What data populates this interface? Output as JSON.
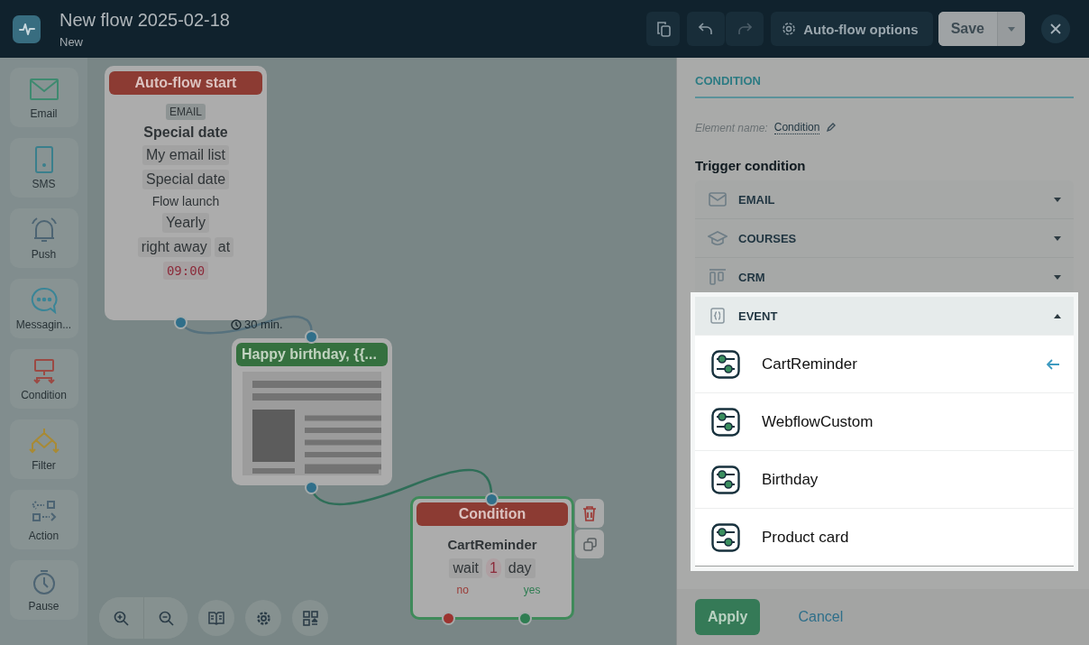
{
  "header": {
    "title": "New flow 2025-02-18",
    "status": "New",
    "options_button": "Auto-flow options",
    "save_button": "Save"
  },
  "palette": [
    {
      "label": "Email",
      "kind": "email"
    },
    {
      "label": "SMS",
      "kind": "sms"
    },
    {
      "label": "Push",
      "kind": "push"
    },
    {
      "label": "Messagin...",
      "kind": "messaging"
    },
    {
      "label": "Condition",
      "kind": "condition"
    },
    {
      "label": "Filter",
      "kind": "filter"
    },
    {
      "label": "Action",
      "kind": "action"
    },
    {
      "label": "Pause",
      "kind": "pause"
    }
  ],
  "canvas": {
    "start_node": {
      "title": "Auto-flow start",
      "lines": [
        {
          "kind": "tag",
          "texts": [
            "EMAIL"
          ]
        },
        {
          "kind": "title",
          "texts": [
            "Special date"
          ]
        },
        {
          "kind": "chip",
          "texts": [
            "My email list"
          ]
        },
        {
          "kind": "chip",
          "texts": [
            "Special date"
          ]
        },
        {
          "kind": "plain",
          "texts": [
            "Flow launch"
          ]
        },
        {
          "kind": "chip",
          "texts": [
            "Yearly"
          ]
        },
        {
          "kind": "chip",
          "texts": [
            "right away",
            "at"
          ]
        },
        {
          "kind": "time",
          "texts": [
            "09:00"
          ]
        }
      ]
    },
    "delay": "30 min.",
    "email_node": {
      "title": "Happy birthday, {{..."
    },
    "condition_node": {
      "title": "Condition",
      "event": "CartReminder",
      "chips": [
        {
          "kind": "chip",
          "text": "wait"
        },
        {
          "kind": "number",
          "text": "1"
        },
        {
          "kind": "chip",
          "text": "day"
        }
      ],
      "no_label": "no",
      "yes_label": "yes"
    }
  },
  "panel": {
    "tab": "CONDITION",
    "element_name_label": "Element name:",
    "element_name": "Condition",
    "section_title": "Trigger condition",
    "sections": [
      {
        "label": "EMAIL",
        "kind": "email",
        "expanded": false
      },
      {
        "label": "COURSES",
        "kind": "courses",
        "expanded": false
      },
      {
        "label": "CRM",
        "kind": "crm",
        "expanded": false
      },
      {
        "label": "EVENT",
        "kind": "event",
        "expanded": true,
        "items": [
          {
            "label": "CartReminder",
            "selected": true
          },
          {
            "label": "WebflowCustom",
            "selected": false
          },
          {
            "label": "Birthday",
            "selected": false
          },
          {
            "label": "Product card",
            "selected": false
          }
        ]
      }
    ],
    "apply_button": "Apply",
    "cancel_button": "Cancel"
  }
}
